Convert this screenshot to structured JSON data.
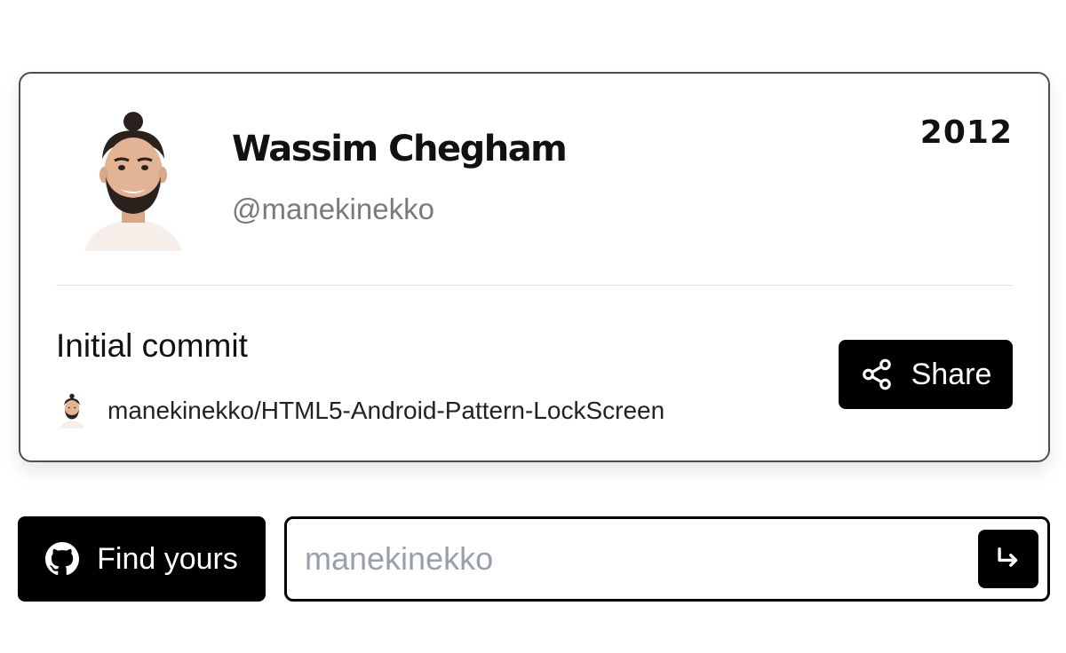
{
  "profile": {
    "name": "Wassim Chegham",
    "handle": "@manekinekko",
    "year": "2012",
    "avatar_icon": "user-avatar-illustration"
  },
  "commit": {
    "message": "Initial commit",
    "repo": "manekinekko/HTML5-Android-Pattern-LockScreen",
    "repo_avatar_icon": "user-avatar-illustration"
  },
  "share_button": {
    "label": "Share",
    "icon": "share-icon"
  },
  "find_button": {
    "label": "Find yours",
    "icon": "github-icon"
  },
  "search": {
    "placeholder": "manekinekko",
    "value": "",
    "submit_icon": "arrow-return-icon"
  },
  "colors": {
    "button_bg": "#000000",
    "card_border": "#4a4f57",
    "handle_text": "#7a7a7a",
    "placeholder": "#9aa0aa"
  }
}
